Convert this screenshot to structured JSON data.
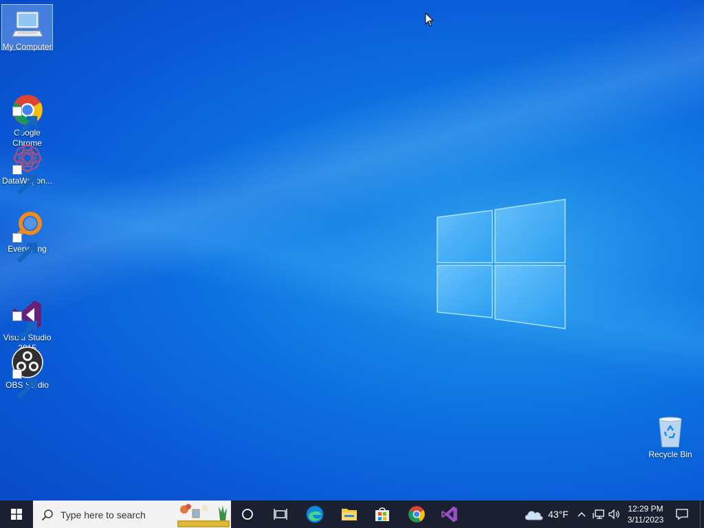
{
  "desktop": {
    "icons": [
      {
        "label": "My Computer",
        "icon": "computer-icon"
      },
      {
        "label": "Google\nChrome",
        "icon": "chrome-icon"
      },
      {
        "label": "DataWagon...",
        "icon": "datawagon-icon"
      },
      {
        "label": "Everything",
        "icon": "everything-icon"
      },
      {
        "label": "Visual Studio\n2015",
        "icon": "visual-studio-icon"
      },
      {
        "label": "OBS Studio",
        "icon": "obs-icon"
      }
    ],
    "recycle_bin": {
      "label": "Recycle Bin",
      "icon": "recycle-bin-icon"
    }
  },
  "taskbar": {
    "search_placeholder": "Type here to search",
    "pinned": [
      "cortana-icon",
      "task-view-icon",
      "edge-icon",
      "file-explorer-icon",
      "store-icon",
      "chrome-icon",
      "visual-studio-icon"
    ],
    "weather": "43°F",
    "time": "12:29 PM",
    "date": "3/11/2023"
  },
  "colors": {
    "taskbar_bg": "#1b2030",
    "desktop_accent": "#0c6fe0",
    "selection": "#b4d7ff"
  }
}
